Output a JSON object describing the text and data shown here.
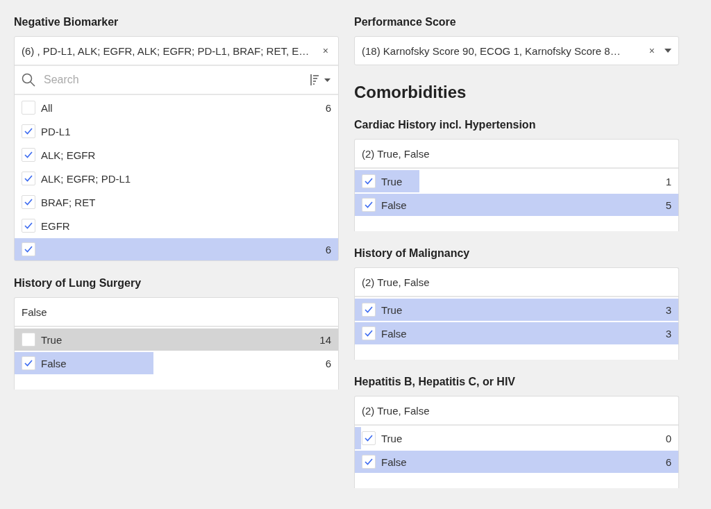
{
  "columns": [
    {
      "sections": [
        {
          "kind": "filter",
          "label": "Negative Biomarker",
          "value": "(6) , PD-L1, ALK; EGFR, ALK; EGFR; PD-L1, BRAF; RET, E…",
          "clear": "×",
          "search": {
            "placeholder": "Search"
          },
          "rows": [
            {
              "label": "All",
              "checked": false,
              "level": 0,
              "count": "6",
              "hovered": false
            },
            {
              "label": "PD-L1",
              "checked": true,
              "level": 0,
              "hovered": false
            },
            {
              "label": "ALK; EGFR",
              "checked": true,
              "level": 0,
              "hovered": false
            },
            {
              "label": "ALK; EGFR; PD-L1",
              "checked": true,
              "level": 0,
              "hovered": false
            },
            {
              "label": "BRAF; RET",
              "checked": true,
              "level": 0,
              "hovered": false
            },
            {
              "label": "EGFR",
              "checked": true,
              "level": 0,
              "hovered": false
            },
            {
              "checked": true,
              "level": 1,
              "count": "6",
              "hovered": false
            }
          ]
        },
        {
          "kind": "filter",
          "label": "History of Lung Surgery",
          "value": "False",
          "rows": [
            {
              "label": "True",
              "checked": false,
              "level": 0,
              "count": "14",
              "hovered": true
            },
            {
              "label": "False",
              "checked": true,
              "level": 0.43,
              "count": "6",
              "hovered": false
            }
          ]
        }
      ]
    },
    {
      "sections": [
        {
          "kind": "filter",
          "label": "Performance Score",
          "value": "(18) Karnofsky Score 90, ECOG 1, Karnofsky Score 8…",
          "clear": "×",
          "dropdown": true
        },
        {
          "kind": "heading",
          "label": "Comorbidities"
        },
        {
          "kind": "filter",
          "label": "Cardiac History incl. Hypertension",
          "value": "(2) True, False",
          "rows": [
            {
              "label": "True",
              "checked": true,
              "level": 0.2,
              "count": "1",
              "hovered": false
            },
            {
              "label": "False",
              "checked": true,
              "level": 1,
              "count": "5",
              "hovered": false
            }
          ]
        },
        {
          "kind": "filter",
          "label": "History of Malignancy",
          "value": "(2) True, False",
          "rows": [
            {
              "label": "True",
              "checked": true,
              "level": 1,
              "count": "3",
              "hovered": false
            },
            {
              "label": "False",
              "checked": true,
              "level": 1,
              "count": "3",
              "hovered": false
            }
          ]
        },
        {
          "kind": "filter",
          "label": "Hepatitis B, Hepatitis C, or HIV",
          "value": "(2) True, False",
          "rows": [
            {
              "label": "True",
              "checked": true,
              "level": 0.02,
              "count": "0",
              "hovered": false
            },
            {
              "label": "False",
              "checked": true,
              "level": 1,
              "count": "6",
              "hovered": false
            }
          ]
        }
      ]
    }
  ]
}
